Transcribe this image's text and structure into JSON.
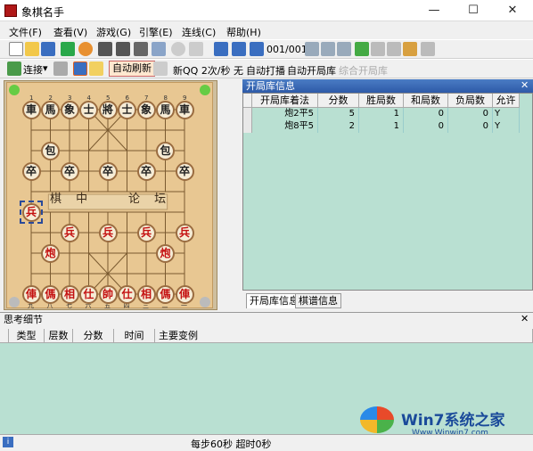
{
  "window": {
    "title": "象棋名手"
  },
  "menu": [
    "文件(F)",
    "查看(V)",
    "游戏(G)",
    "引擎(E)",
    "连线(C)",
    "帮助(H)"
  ],
  "toolbar1": {
    "move_counter": "001/001"
  },
  "toolbar2": {
    "connect": "连接",
    "auto_refresh": "自动刷新",
    "speed": "新QQ 2次/秒 无",
    "auto_play": "自动打播",
    "auto_book": "自动开局库",
    "combined_book": "综合开局库"
  },
  "board": {
    "river_left": "棋 中",
    "river_right": "论 坛",
    "file_numbers_top": [
      "1",
      "2",
      "3",
      "4",
      "5",
      "6",
      "7",
      "8",
      "9"
    ],
    "file_numbers_bottom": [
      "九",
      "八",
      "七",
      "六",
      "五",
      "四",
      "三",
      "二",
      "一"
    ],
    "pieces": [
      {
        "c": "b",
        "t": "車",
        "f": 0,
        "r": 0
      },
      {
        "c": "b",
        "t": "馬",
        "f": 1,
        "r": 0
      },
      {
        "c": "b",
        "t": "象",
        "f": 2,
        "r": 0
      },
      {
        "c": "b",
        "t": "士",
        "f": 3,
        "r": 0
      },
      {
        "c": "b",
        "t": "將",
        "f": 4,
        "r": 0
      },
      {
        "c": "b",
        "t": "士",
        "f": 5,
        "r": 0
      },
      {
        "c": "b",
        "t": "象",
        "f": 6,
        "r": 0
      },
      {
        "c": "b",
        "t": "馬",
        "f": 7,
        "r": 0
      },
      {
        "c": "b",
        "t": "車",
        "f": 8,
        "r": 0
      },
      {
        "c": "b",
        "t": "包",
        "f": 1,
        "r": 2
      },
      {
        "c": "b",
        "t": "包",
        "f": 7,
        "r": 2
      },
      {
        "c": "b",
        "t": "卒",
        "f": 0,
        "r": 3
      },
      {
        "c": "b",
        "t": "卒",
        "f": 2,
        "r": 3
      },
      {
        "c": "b",
        "t": "卒",
        "f": 4,
        "r": 3
      },
      {
        "c": "b",
        "t": "卒",
        "f": 6,
        "r": 3
      },
      {
        "c": "b",
        "t": "卒",
        "f": 8,
        "r": 3
      },
      {
        "c": "r",
        "t": "兵",
        "f": 0,
        "r": 5
      },
      {
        "c": "r",
        "t": "兵",
        "f": 2,
        "r": 6
      },
      {
        "c": "r",
        "t": "兵",
        "f": 4,
        "r": 6
      },
      {
        "c": "r",
        "t": "兵",
        "f": 6,
        "r": 6
      },
      {
        "c": "r",
        "t": "兵",
        "f": 8,
        "r": 6
      },
      {
        "c": "r",
        "t": "炮",
        "f": 1,
        "r": 7
      },
      {
        "c": "r",
        "t": "炮",
        "f": 7,
        "r": 7
      },
      {
        "c": "r",
        "t": "俥",
        "f": 0,
        "r": 9
      },
      {
        "c": "r",
        "t": "傌",
        "f": 1,
        "r": 9
      },
      {
        "c": "r",
        "t": "相",
        "f": 2,
        "r": 9
      },
      {
        "c": "r",
        "t": "仕",
        "f": 3,
        "r": 9
      },
      {
        "c": "r",
        "t": "帥",
        "f": 4,
        "r": 9
      },
      {
        "c": "r",
        "t": "仕",
        "f": 5,
        "r": 9
      },
      {
        "c": "r",
        "t": "相",
        "f": 6,
        "r": 9
      },
      {
        "c": "r",
        "t": "傌",
        "f": 7,
        "r": 9
      },
      {
        "c": "r",
        "t": "俥",
        "f": 8,
        "r": 9
      }
    ]
  },
  "book": {
    "header": "开局库信息",
    "columns": [
      "开局库着法",
      "分数",
      "胜局数",
      "和局数",
      "负局数",
      "允许"
    ],
    "rows": [
      [
        "炮2平5",
        "5",
        "1",
        "0",
        "0",
        "Y"
      ],
      [
        "炮8平5",
        "2",
        "1",
        "0",
        "0",
        "Y"
      ]
    ],
    "tabs": [
      "开局库信息",
      "棋谱信息"
    ]
  },
  "think": {
    "header": "思考细节",
    "columns": [
      "类型",
      "层数",
      "分数",
      "时间",
      "主要变例"
    ]
  },
  "status": {
    "text": "每步60秒 超时0秒"
  },
  "watermark": {
    "brand": "Win7系统之家",
    "url": "Www.Winwin7.com"
  }
}
